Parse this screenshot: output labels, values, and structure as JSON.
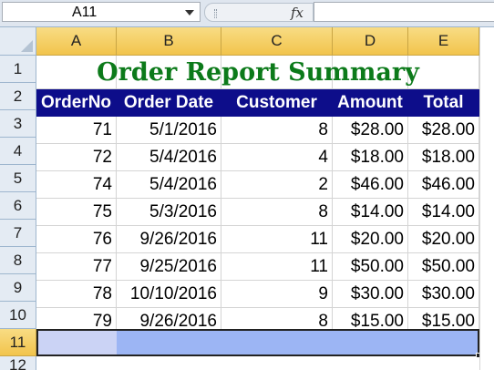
{
  "formula_bar": {
    "name_box": "A11",
    "fx_label": "fx",
    "formula": ""
  },
  "columns": [
    "A",
    "B",
    "C",
    "D",
    "E"
  ],
  "rows": [
    "1",
    "2",
    "3",
    "4",
    "5",
    "6",
    "7",
    "8",
    "9",
    "10",
    "11",
    "12"
  ],
  "title": "Order Report Summary",
  "headers": [
    "OrderNo",
    "Order Date",
    "Customer",
    "Amount",
    "Total"
  ],
  "data": [
    [
      "71",
      "5/1/2016",
      "8",
      "$28.00",
      "$28.00"
    ],
    [
      "72",
      "5/4/2016",
      "4",
      "$18.00",
      "$18.00"
    ],
    [
      "74",
      "5/4/2016",
      "2",
      "$46.00",
      "$46.00"
    ],
    [
      "75",
      "5/3/2016",
      "8",
      "$14.00",
      "$14.00"
    ],
    [
      "76",
      "9/26/2016",
      "11",
      "$20.00",
      "$20.00"
    ],
    [
      "77",
      "9/25/2016",
      "11",
      "$50.00",
      "$50.00"
    ],
    [
      "78",
      "10/10/2016",
      "9",
      "$30.00",
      "$30.00"
    ],
    [
      "79",
      "9/26/2016",
      "8",
      "$15.00",
      "$15.00"
    ]
  ],
  "selected_row": "11",
  "colors": {
    "title": "#0c7a1a",
    "header_bg": "#0d0d8a",
    "header_text": "#ffffff",
    "selection": "#9cb5f4"
  }
}
